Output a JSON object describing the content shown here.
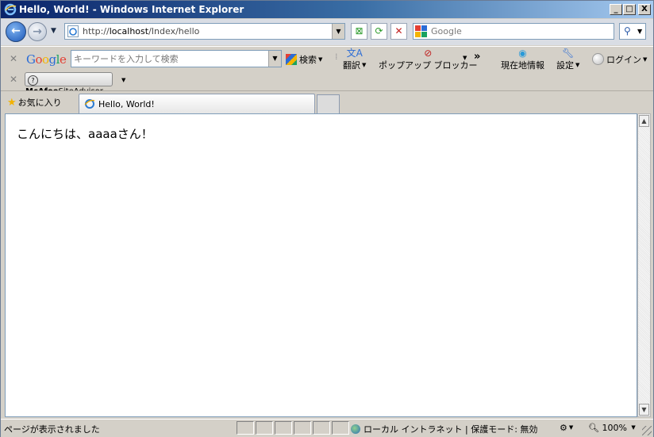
{
  "window": {
    "title": "Hello, World! - Windows Internet Explorer",
    "min_label": "_",
    "max_label": "□",
    "close_label": "X"
  },
  "navigation": {
    "address_prefix": "http://",
    "address_host": "localhost",
    "address_path": "/Index/hello",
    "search_placeholder": "Google"
  },
  "google_toolbar": {
    "logo": "Google",
    "search_placeholder": "キーワードを入力して検索",
    "search_label": "検索",
    "translate_label": "翻訳",
    "popup_blocker_label": "ポップアップ ブロッカー",
    "more_label": "»",
    "location_label": "現在地情報",
    "settings_label": "設定",
    "login_label": "ログイン"
  },
  "mcafee_toolbar": {
    "brand": "McAfee",
    "product": "SiteAdvisor"
  },
  "favorites": {
    "label": "お気に入り"
  },
  "tabs": [
    {
      "title": "Hello, World!"
    }
  ],
  "content": {
    "greeting": "こんにちは、aaaaさん！"
  },
  "statusbar": {
    "status": "ページが表示されました",
    "zone": "ローカル イントラネット | 保護モード: 無効",
    "zoom": "100%"
  }
}
